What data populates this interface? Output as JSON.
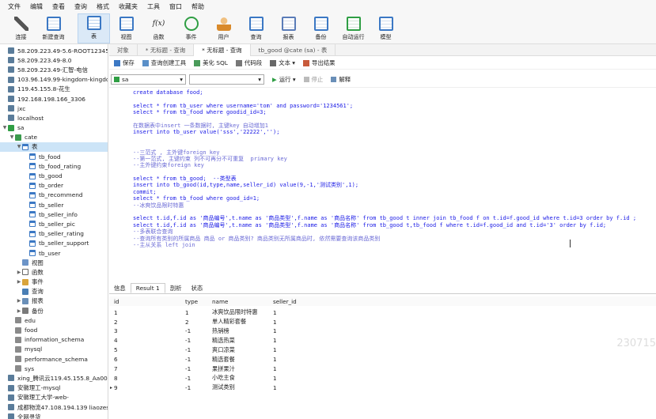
{
  "menu": [
    "文件",
    "编辑",
    "查看",
    "查询",
    "格式",
    "收藏夹",
    "工具",
    "窗口",
    "帮助"
  ],
  "toolbar": [
    {
      "label": "连接",
      "icon": "plug-icon"
    },
    {
      "label": "新建查询",
      "icon": "new-query-icon"
    },
    {
      "label": "表",
      "icon": "table-icon"
    },
    {
      "label": "视图",
      "icon": "view-icon"
    },
    {
      "label": "函数",
      "icon": "function-icon"
    },
    {
      "label": "事件",
      "icon": "clock-icon"
    },
    {
      "label": "用户",
      "icon": "user-icon"
    },
    {
      "label": "查询",
      "icon": "query-icon"
    },
    {
      "label": "报表",
      "icon": "report-icon"
    },
    {
      "label": "备份",
      "icon": "backup-icon"
    },
    {
      "label": "自动运行",
      "icon": "automation-icon"
    },
    {
      "label": "模型",
      "icon": "model-icon"
    }
  ],
  "sidebar": {
    "items": [
      {
        "label": "58.209.223.49-5.6-ROOT123456",
        "level": 0,
        "kind": "conn"
      },
      {
        "label": "58.209.223.49-8.0",
        "level": 0,
        "kind": "conn"
      },
      {
        "label": "58.209.223.49-汇智-电信",
        "level": 0,
        "kind": "conn"
      },
      {
        "label": "103.96.149.99-kingdom-kingdom",
        "level": 0,
        "kind": "conn"
      },
      {
        "label": "119.45.155.8-花生",
        "level": 0,
        "kind": "conn"
      },
      {
        "label": "192.168.198.166_3306",
        "level": 0,
        "kind": "conn"
      },
      {
        "label": "jxc",
        "level": 0,
        "kind": "conn"
      },
      {
        "label": "localhost",
        "level": 0,
        "kind": "conn"
      },
      {
        "label": "sa",
        "level": 0,
        "kind": "conn-ok",
        "expanded": true
      },
      {
        "label": "cate",
        "level": 1,
        "kind": "db",
        "expanded": true
      },
      {
        "label": "表",
        "level": 2,
        "kind": "table",
        "expanded": true,
        "selected": true
      },
      {
        "label": "tb_food",
        "level": 3,
        "kind": "table"
      },
      {
        "label": "tb_food_rating",
        "level": 3,
        "kind": "table"
      },
      {
        "label": "tb_good",
        "level": 3,
        "kind": "table"
      },
      {
        "label": "tb_order",
        "level": 3,
        "kind": "table"
      },
      {
        "label": "tb_recommend",
        "level": 3,
        "kind": "table"
      },
      {
        "label": "tb_seller",
        "level": 3,
        "kind": "table"
      },
      {
        "label": "tb_seller_info",
        "level": 3,
        "kind": "table"
      },
      {
        "label": "tb_seller_pic",
        "level": 3,
        "kind": "table"
      },
      {
        "label": "tb_seller_rating",
        "level": 3,
        "kind": "table"
      },
      {
        "label": "tb_seller_support",
        "level": 3,
        "kind": "table"
      },
      {
        "label": "tb_user",
        "level": 3,
        "kind": "table"
      },
      {
        "label": "视图",
        "level": 2,
        "kind": "view"
      },
      {
        "label": "函数",
        "level": 2,
        "kind": "fn",
        "collapsed": true
      },
      {
        "label": "事件",
        "level": 2,
        "kind": "ev",
        "collapsed": true
      },
      {
        "label": "查询",
        "level": 2,
        "kind": "q"
      },
      {
        "label": "报表",
        "level": 2,
        "kind": "rp",
        "collapsed": true
      },
      {
        "label": "备份",
        "level": 2,
        "kind": "bk",
        "collapsed": true
      },
      {
        "label": "edu",
        "level": 1,
        "kind": "db-grey"
      },
      {
        "label": "food",
        "level": 1,
        "kind": "db-grey"
      },
      {
        "label": "information_schema",
        "level": 1,
        "kind": "db-grey"
      },
      {
        "label": "mysql",
        "level": 1,
        "kind": "db-grey"
      },
      {
        "label": "performance_schema",
        "level": 1,
        "kind": "db-grey"
      },
      {
        "label": "sys",
        "level": 1,
        "kind": "db-grey"
      },
      {
        "label": "xing_腾讯云119.45.155.8_Aa0011",
        "level": 0,
        "kind": "conn"
      },
      {
        "label": "安徽理工-mysql",
        "level": 0,
        "kind": "conn"
      },
      {
        "label": "安徽理工大学-web-",
        "level": 0,
        "kind": "conn"
      },
      {
        "label": "成都物流47.108.194.139 liaozesc",
        "level": 0,
        "kind": "conn"
      },
      {
        "label": "全网寻货",
        "level": 0,
        "kind": "conn"
      }
    ]
  },
  "tabs": [
    {
      "label": "对象",
      "active": false
    },
    {
      "label": "* 无标题 - 查询",
      "active": false
    },
    {
      "label": "* 无标题 - 查询",
      "active": true
    },
    {
      "label": "tb_good @cate (sa) - 表",
      "active": false
    }
  ],
  "query_toolbar": [
    {
      "label": "保存",
      "color": "#3b78c4"
    },
    {
      "label": "查询创建工具",
      "color": "#5a8fc8"
    },
    {
      "label": "美化 SQL",
      "color": "#4a9b5a"
    },
    {
      "label": "代码段",
      "color": "#777777"
    },
    {
      "label": "文本 ▾",
      "color": "#666666"
    },
    {
      "label": "导出结果",
      "color": "#c85a3b"
    }
  ],
  "selectors": {
    "connection": "sa",
    "database": "",
    "run": "运行 ▾",
    "stop": "停止",
    "explain": "解释"
  },
  "editor_lines": [
    {
      "t": "create database food;",
      "c": false
    },
    {
      "t": "",
      "c": false
    },
    {
      "t": "select * from tb_user where username='tom' and password='1234561';",
      "c": false
    },
    {
      "t": "select * from tb_food where goodid_id=3;",
      "c": false
    },
    {
      "t": "",
      "c": false
    },
    {
      "t": "在数据表中insert 一条数据时, 主键key 自动增加1",
      "c": true
    },
    {
      "t": "insert into tb_user value('sss','22222','');",
      "c": false
    },
    {
      "t": "",
      "c": false
    },
    {
      "t": "",
      "c": false
    },
    {
      "t": "--三范式 , 主外键foreign key",
      "c": true
    },
    {
      "t": "--第一范式, 主键约束 列不可再分不可重复  primary key",
      "c": true
    },
    {
      "t": "--主外键约束foreign key",
      "c": true
    },
    {
      "t": "",
      "c": false
    },
    {
      "t": "select * from tb_good;  --类型表",
      "c": false
    },
    {
      "t": "insert into tb_good(id,type,name,seller_id) value(9,-1,'测试类别',1);",
      "c": false
    },
    {
      "t": "commit;",
      "c": false
    },
    {
      "t": "select * from tb_food where good_id=1;",
      "c": false
    },
    {
      "t": "--冰爽饮品限时特惠",
      "c": true
    },
    {
      "t": "",
      "c": false
    },
    {
      "t": "select t.id,f.id as '商品编号',t.name as '商品类型',f.name as '商品名称' from tb_good t inner join tb_food f on t.id=f.good_id where t.id=3 order by f.id ;",
      "c": false
    },
    {
      "t": "select t.id,f.id as '商品编号',t.name as '商品类型',f.name as '商品名称' from tb_good t,tb_food f where t.id=f.good_id and t.id='3' order by f.id;",
      "c": false
    },
    {
      "t": "--多表联合查询",
      "c": true
    },
    {
      "t": "--查询所有类别的所属商品 商品 or 商品类别? 商品类别无所属商品时, 依然需要查询该商品类别",
      "c": true
    },
    {
      "t": "--主从关系 left join",
      "c": true
    }
  ],
  "result_tabs": [
    {
      "label": "信息",
      "active": false
    },
    {
      "label": "Result 1",
      "active": true
    },
    {
      "label": "剖析",
      "active": false
    },
    {
      "label": "状态",
      "active": false
    }
  ],
  "grid": {
    "columns": [
      "id",
      "type",
      "name",
      "seller_id"
    ],
    "rows": [
      [
        "1",
        "1",
        "冰爽饮品限时特惠",
        "1"
      ],
      [
        "2",
        "2",
        "单人精彩套餐",
        "1"
      ],
      [
        "3",
        "-1",
        "热销榜",
        "1"
      ],
      [
        "4",
        "-1",
        "精选热菜",
        "1"
      ],
      [
        "5",
        "-1",
        "爽口凉菜",
        "1"
      ],
      [
        "6",
        "-1",
        "精选套餐",
        "1"
      ],
      [
        "7",
        "-1",
        "果拼果汁",
        "1"
      ],
      [
        "8",
        "-1",
        "小吃主食",
        "1"
      ],
      [
        "9",
        "-1",
        "测试类别",
        "1"
      ]
    ]
  },
  "watermark": "230715"
}
